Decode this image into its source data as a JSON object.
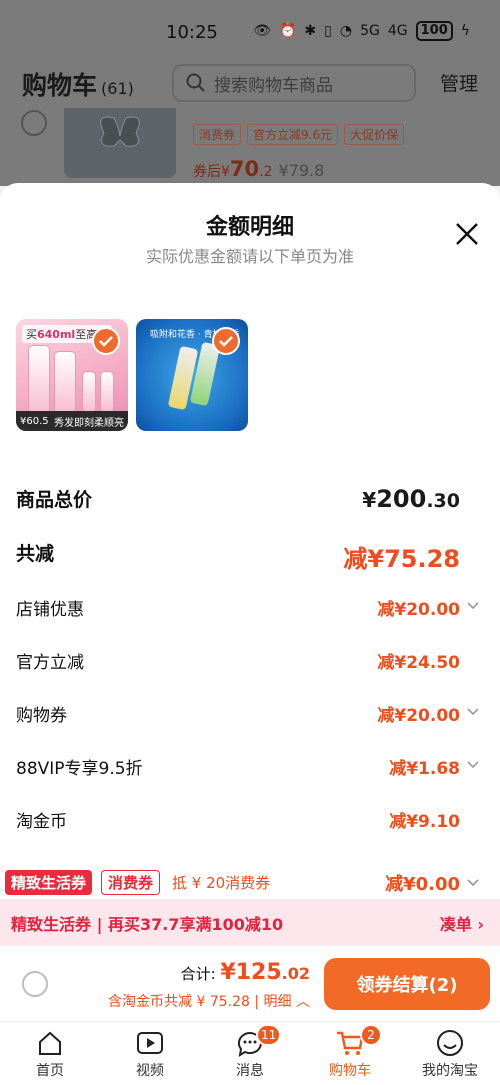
{
  "status_bar": {
    "time": "10:25",
    "battery": "100",
    "net1": "5G",
    "net2": "4G"
  },
  "header": {
    "title": "购物车",
    "count": "(61)",
    "search_placeholder": "搜索购物车商品",
    "manage": "管理"
  },
  "background_item": {
    "tags": [
      "消费券",
      "官方立减9.6元",
      "大促价保"
    ],
    "price_prefix": "券后¥",
    "price_int": "70",
    "price_dec": ".2",
    "orig_price": "¥79.8"
  },
  "sheet": {
    "title": "金额明细",
    "subtitle": "实际优惠金额请以下单页为准",
    "thumb1": {
      "banner_pre": "买",
      "banner_hl": "640ml",
      "banner_post": "至高得",
      "foot_left": "¥60.5",
      "foot_right": "秀发即刻柔顺亮"
    },
    "thumb2": {
      "caption": "吸附和花香 · 青柠花香"
    },
    "total": {
      "label": "商品总价",
      "currency": "¥",
      "int": "200",
      "dec": ".30"
    },
    "reduced": {
      "label": "共减",
      "value": "减¥75.28"
    },
    "items": [
      {
        "label": "店铺优惠",
        "value": "减¥20.00"
      },
      {
        "label": "官方立减",
        "value": "减¥24.50"
      },
      {
        "label": "购物券",
        "value": "减¥20.00"
      },
      {
        "label": "88VIP专享9.5折",
        "value": "减¥1.68"
      },
      {
        "label": "淘金币",
        "value": "减¥9.10"
      }
    ],
    "coupon_row": {
      "tag1": "精致生活券",
      "tag2": "消费券",
      "desc": "抵 ¥ 20消费券",
      "value": "减¥0.00"
    }
  },
  "promo": {
    "text": "精致生活券 | 再买37.7享满100减10",
    "link": "凑单"
  },
  "checkout": {
    "total_label": "合计: ",
    "amount": "¥125",
    "amount_dec": ".02",
    "sub": "含淘金币共减 ¥ 75.28 | 明细",
    "button": "领券结算(2)"
  },
  "tabs": [
    {
      "label": "首页"
    },
    {
      "label": "视频"
    },
    {
      "label": "消息",
      "badge": "11"
    },
    {
      "label": "购物车",
      "badge": "2"
    },
    {
      "label": "我的淘宝"
    }
  ],
  "colors": {
    "accent": "#ef4d1c",
    "button": "#f36a27",
    "promo_red": "#e0233e"
  }
}
